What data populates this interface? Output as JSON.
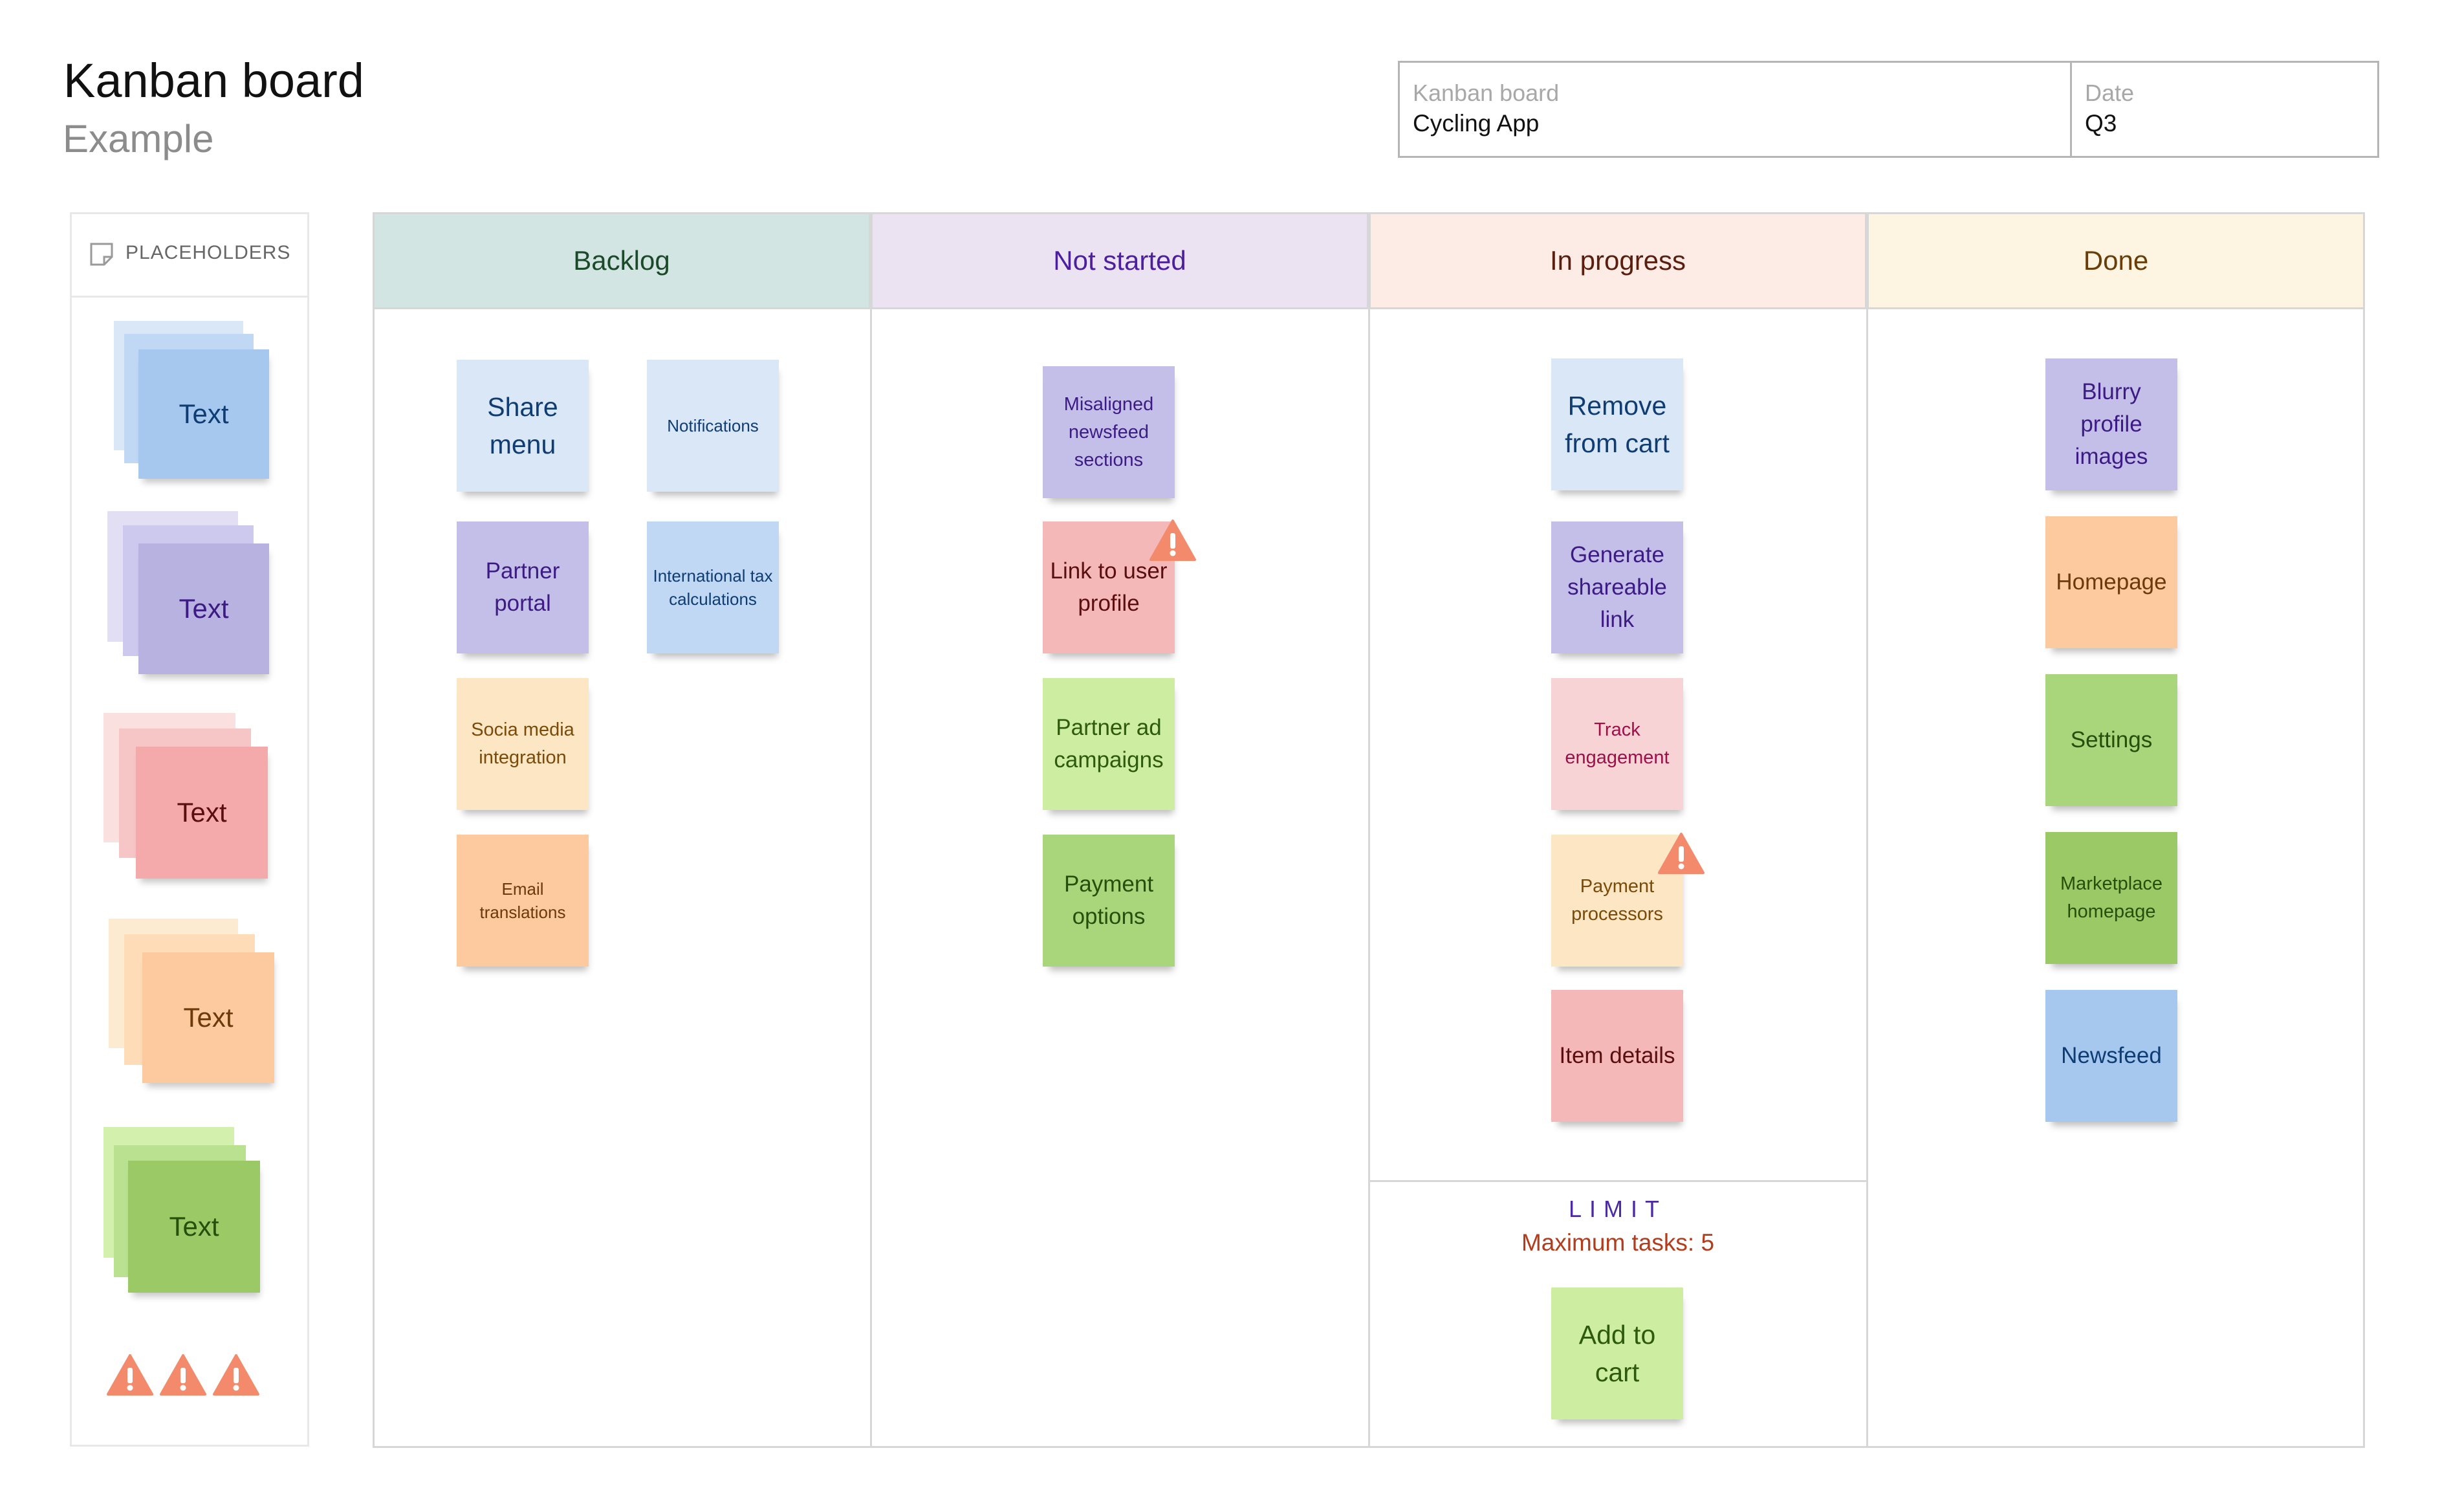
{
  "header": {
    "title": "Kanban board",
    "subtitle": "Example"
  },
  "info": {
    "board_label": "Kanban board",
    "board_value": "Cycling App",
    "date_label": "Date",
    "date_value": "Q3"
  },
  "placeholders": {
    "label": "PLACEHOLDERS",
    "stack_text": [
      "Text",
      "Text",
      "Text",
      "Text",
      "Text"
    ]
  },
  "columns": [
    {
      "title": "Backlog",
      "color": "#d3e5e3",
      "text_color": "#1b4a2a"
    },
    {
      "title": "Not started",
      "color": "#ece3f2",
      "text_color": "#4b1f9e"
    },
    {
      "title": "In progress",
      "color": "#fdebe6",
      "text_color": "#5a1e0e"
    },
    {
      "title": "Done",
      "color": "#fdf4e1",
      "text_color": "#6a3d08"
    }
  ],
  "backlog": {
    "share_menu": "Share menu",
    "notifications": "Notifications",
    "partner_portal": "Partner portal",
    "intl_tax": "International tax calculations",
    "social_media": "Socia media integration",
    "email_translations": "Email translations"
  },
  "not_started": {
    "misaligned": "Misaligned newsfeed sections",
    "link_profile": "Link to user profile",
    "partner_ad": "Partner ad campaigns",
    "payment_options": "Payment options"
  },
  "in_progress": {
    "remove_cart": "Remove from cart",
    "generate_link": "Generate shareable link",
    "track_engagement": "Track engagement",
    "payment_processors": "Payment processors",
    "item_details": "Item details"
  },
  "limit": {
    "title": "LIMIT",
    "text": "Maximum tasks:  5",
    "note": "Add to cart"
  },
  "done": {
    "blurry": "Blurry profile images",
    "homepage": "Homepage",
    "settings": "Settings",
    "marketplace": "Marketplace homepage",
    "newsfeed": "Newsfeed"
  },
  "colors": {
    "blue_light": "#dae7f6",
    "blue": "#a6c8ef",
    "blue_mid": "#c0d8f3",
    "lavender": "#c4bfe8",
    "lavender_dark": "#b7b2df",
    "pink": "#f4b8b8",
    "pink_light": "#f8d3d6",
    "peach_light": "#fde6c4",
    "orange": "#fdc99e",
    "green_light": "#cdeea0",
    "green": "#a9d67b",
    "green_dark": "#9bc965",
    "warning": "#f38a6b"
  }
}
